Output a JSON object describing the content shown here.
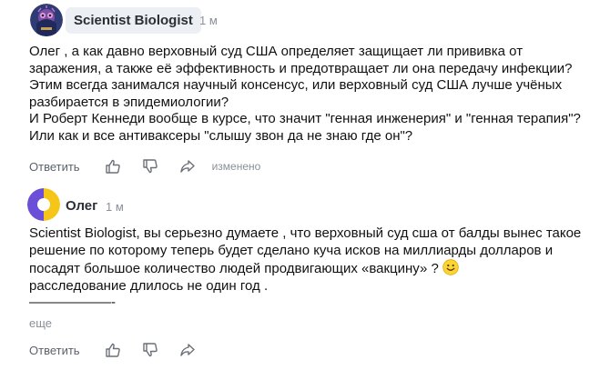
{
  "comments": [
    {
      "author": "Scientist Biologist",
      "time": "1 м",
      "paragraphs": [
        "Олег , а как давно верховный суд США определяет защищает ли прививка от заражения, а также её эффективность и предотвращает ли она передачу инфекции? Этим всегда занимался научный консенсус, или верховный суд США лучше учёных разбирается в эпидемиологии?",
        "И Роберт Кеннеди вообще в курсе, что значит \"генная инженерия\" и \"генная терапия\"? Или как и все антиваксеры \"слышу звон да не знаю где он\"?"
      ],
      "reply_label": "Ответить",
      "edited_label": "изменено"
    },
    {
      "author": "Олег",
      "time": "1 м",
      "paragraphs": [
        "Scientist Biologist, вы серьезно думаете , что верховный суд сша от балды вынес такое решение по которому теперь будет сделано куча исков на миллиарды долларов и посадят большое количество людей продвигающих «вакцину» ?",
        "расследование длилось не один год ."
      ],
      "dash_line": "——————-",
      "more_label": "еще",
      "reply_label": "Ответить"
    }
  ],
  "icons": {
    "like": "thumbs-up-icon",
    "dislike": "thumbs-down-icon",
    "share": "share-icon",
    "emoji": "smiling-face-emoji"
  },
  "colors": {
    "author_pill_bg": "#eceff3",
    "muted_text": "#8a8f98",
    "avatar2_purple": "#6b4fd8",
    "avatar2_yellow": "#f5c518"
  }
}
